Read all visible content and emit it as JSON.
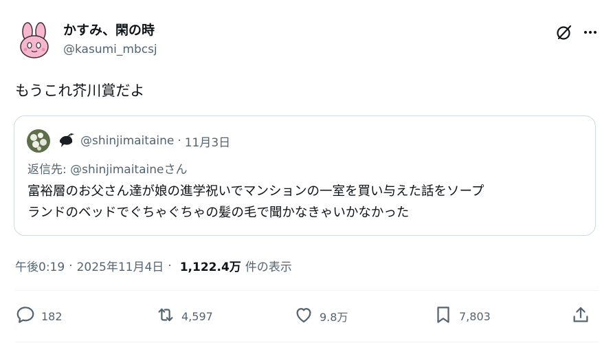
{
  "author": {
    "display_name": "かすみ、閑の時",
    "handle": "@kasumi_mbcsj"
  },
  "tweet": {
    "text": "もうこれ芥川賞だよ"
  },
  "quote": {
    "handle": "@shinjimaitaine",
    "separator": "·",
    "date": "11月3日",
    "reply_prefix": "返信先: ",
    "reply_handle": "@shinjimaitaine",
    "reply_suffix": "さん",
    "line1": "富裕層のお父さん達が娘の進学祝いでマンションの一室を買い与えた話をソープ",
    "line2": "ランドのベッドでぐちゃぐちゃの髪の毛で聞かなきゃいかなかった"
  },
  "meta": {
    "time": "午後0:19",
    "sep1": "·",
    "date": "2025年11月4日",
    "sep2": "·",
    "views": "1,122.4万",
    "views_label": "件の表示"
  },
  "actions": {
    "reply_count": "182",
    "retweet_count": "4,597",
    "like_count": "9.8万",
    "bookmark_count": "7,803"
  },
  "icons": {
    "header": [
      "grok-icon",
      "more-icon"
    ],
    "actions": [
      "reply-icon",
      "retweet-icon",
      "like-icon",
      "bookmark-icon",
      "share-icon"
    ]
  },
  "colors": {
    "text": "#0f1419",
    "secondary": "#536471",
    "border": "#cfd9de",
    "avatar_pink": "#f7b8cf"
  }
}
